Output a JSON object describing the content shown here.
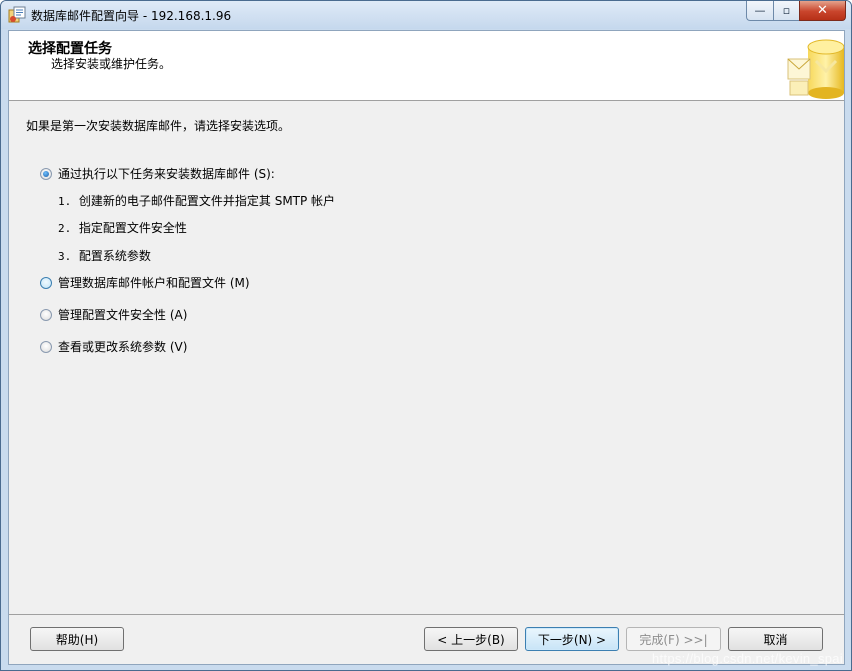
{
  "window": {
    "title": "数据库邮件配置向导 - 192.168.1.96",
    "caption_min": "—",
    "caption_max": "▫",
    "caption_close": "✕"
  },
  "header": {
    "title": "选择配置任务",
    "subtitle": "选择安装或维护任务。"
  },
  "intro": "如果是第一次安装数据库邮件，请选择安装选项。",
  "options": [
    {
      "label": "通过执行以下任务来安装数据库邮件 (S):",
      "checked": true
    },
    {
      "label": "管理数据库邮件帐户和配置文件 (M)",
      "checked": false
    },
    {
      "label": "管理配置文件安全性 (A)",
      "checked": false
    },
    {
      "label": "查看或更改系统参数 (V)",
      "checked": false
    }
  ],
  "steps": [
    {
      "num": "1.",
      "text": "创建新的电子邮件配置文件并指定其 SMTP 帐户"
    },
    {
      "num": "2.",
      "text": "指定配置文件安全性"
    },
    {
      "num": "3.",
      "text": "配置系统参数"
    }
  ],
  "buttons": {
    "help": "帮助(H)",
    "back": "< 上一步(B)",
    "next": "下一步(N) >",
    "finish": "完成(F) >>|",
    "cancel": "取消"
  },
  "watermark": "https://blog.csdn.net/kevin_spai",
  "colors": {
    "accent": "#3c7fb1",
    "title_bar": "#c9dbee",
    "close_button": "#c9452c"
  }
}
